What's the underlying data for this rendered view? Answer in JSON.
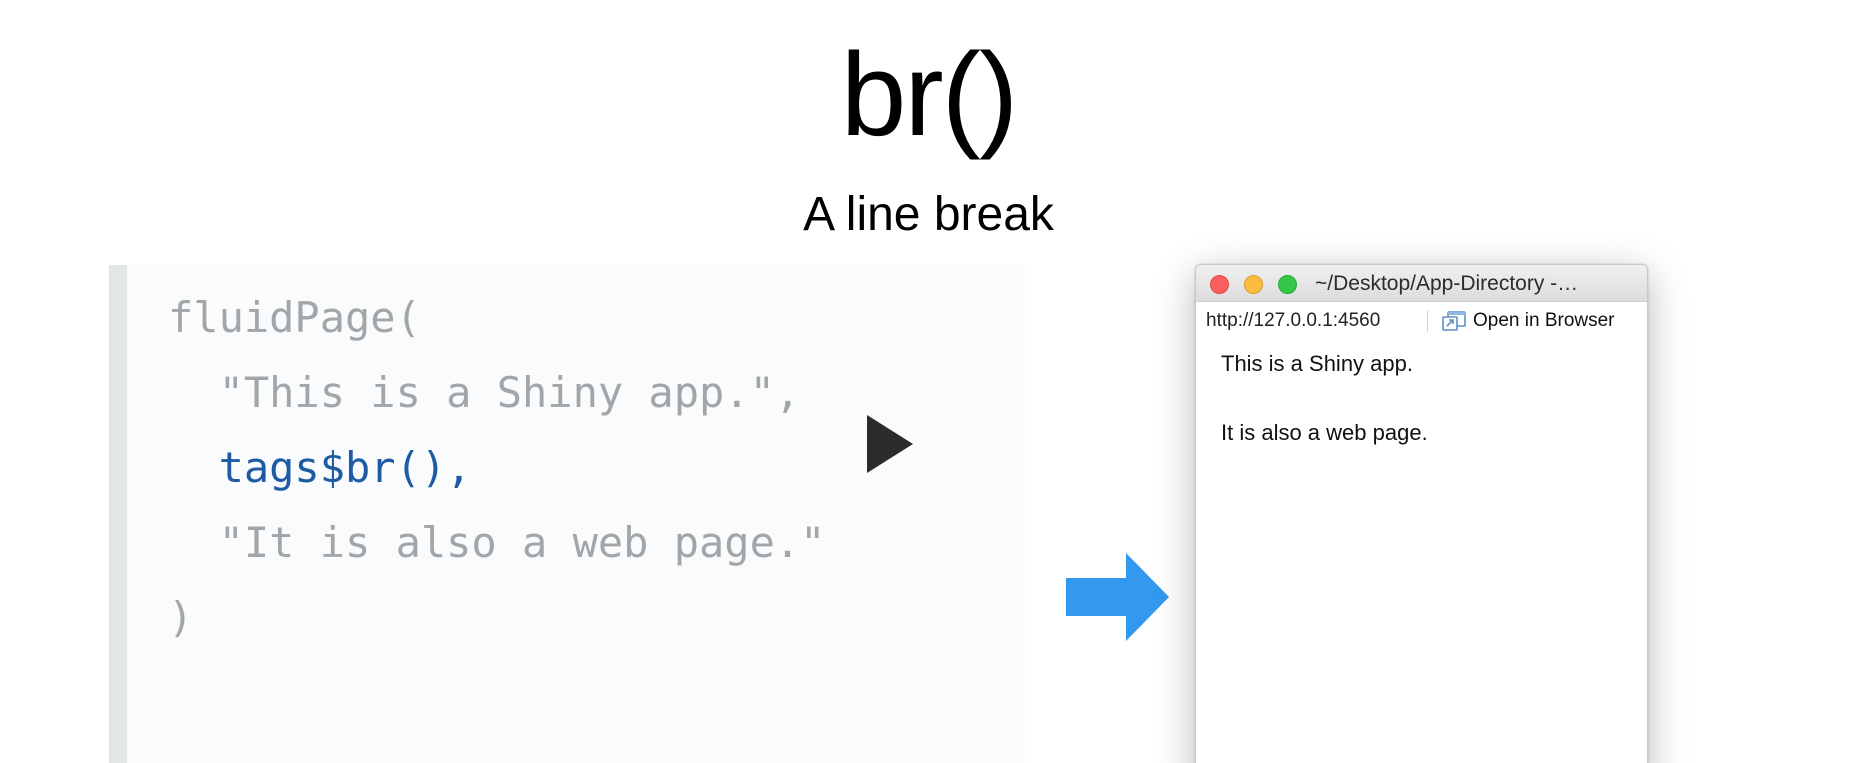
{
  "slide": {
    "title": "br()",
    "subtitle": "A line break"
  },
  "code": {
    "lines": [
      "fluidPage(",
      "  \"This is a Shiny app.\",",
      "  tags$br(),",
      "  \"It is also a web page.\"",
      ")"
    ],
    "highlighted_line_index": 2,
    "text_color": "#a3a6a8",
    "highlight_color": "#1f5ba5",
    "panel_background": "#f9fbfc"
  },
  "icons": {
    "run": "play-triangle-icon",
    "result_arrow": "right-arrow-icon",
    "arrow_color": "#3399ee"
  },
  "app_window": {
    "title": "~/Desktop/App-Directory -…",
    "url": "http://127.0.0.1:4560",
    "open_in_browser_label": "Open in Browser",
    "content": [
      "This is a Shiny app.",
      "It is also a web page."
    ]
  }
}
